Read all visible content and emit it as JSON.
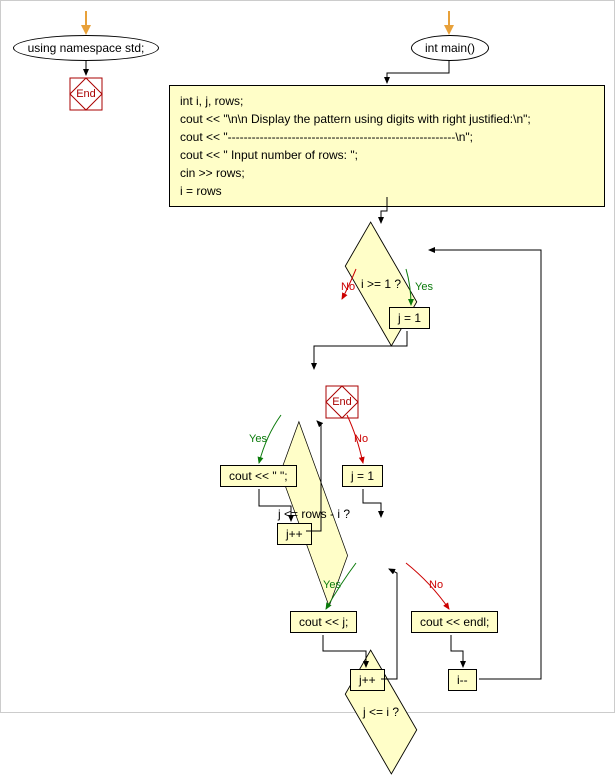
{
  "chart_data": {
    "type": "flowchart",
    "nodes": [
      {
        "id": "n1",
        "type": "ellipse",
        "label": "using namespace std;"
      },
      {
        "id": "n2",
        "type": "terminator",
        "label": "End"
      },
      {
        "id": "n3",
        "type": "ellipse",
        "label": "int main()"
      },
      {
        "id": "n4",
        "type": "process",
        "lines": [
          "int i, j, rows;",
          "cout << \"\\n\\n Display the pattern using digits with right justified:\\n\";",
          "cout << \"---------------------------------------------------------\\n\";",
          "cout << \" Input number of rows: \";",
          "cin >> rows;",
          "i = rows"
        ]
      },
      {
        "id": "n5",
        "type": "decision",
        "label": "i >= 1 ?"
      },
      {
        "id": "n6",
        "type": "terminator",
        "label": "End"
      },
      {
        "id": "n7",
        "type": "process",
        "label": "j = 1"
      },
      {
        "id": "n8",
        "type": "decision",
        "label": "j <= rows - i ?"
      },
      {
        "id": "n9",
        "type": "process",
        "label": "cout << \" \";"
      },
      {
        "id": "n10",
        "type": "process",
        "label": "j = 1"
      },
      {
        "id": "n11",
        "type": "process",
        "label": "j++"
      },
      {
        "id": "n12",
        "type": "decision",
        "label": "j <= i ?"
      },
      {
        "id": "n13",
        "type": "process",
        "label": "cout << j;"
      },
      {
        "id": "n14",
        "type": "process",
        "label": "cout << endl;"
      },
      {
        "id": "n15",
        "type": "process",
        "label": "j++"
      },
      {
        "id": "n16",
        "type": "process",
        "label": "i--"
      }
    ],
    "edges": [
      {
        "from": "entry1",
        "to": "n1"
      },
      {
        "from": "n1",
        "to": "n2"
      },
      {
        "from": "entry2",
        "to": "n3"
      },
      {
        "from": "n3",
        "to": "n4"
      },
      {
        "from": "n4",
        "to": "n5"
      },
      {
        "from": "n5",
        "to": "n6",
        "label": "No"
      },
      {
        "from": "n5",
        "to": "n7",
        "label": "Yes"
      },
      {
        "from": "n7",
        "to": "n8"
      },
      {
        "from": "n8",
        "to": "n9",
        "label": "Yes"
      },
      {
        "from": "n8",
        "to": "n10",
        "label": "No"
      },
      {
        "from": "n9",
        "to": "n11"
      },
      {
        "from": "n11",
        "to": "n8"
      },
      {
        "from": "n10",
        "to": "n12"
      },
      {
        "from": "n12",
        "to": "n13",
        "label": "Yes"
      },
      {
        "from": "n12",
        "to": "n14",
        "label": "No"
      },
      {
        "from": "n13",
        "to": "n15"
      },
      {
        "from": "n15",
        "to": "n12"
      },
      {
        "from": "n14",
        "to": "n16"
      },
      {
        "from": "n16",
        "to": "n5"
      }
    ]
  },
  "labels": {
    "yes": "Yes",
    "no": "No"
  }
}
